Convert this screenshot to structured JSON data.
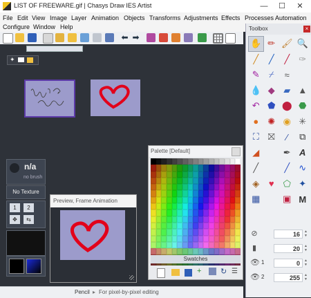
{
  "window": {
    "title": "LIST OF FREEWARE.gif | Chasys Draw IES Artist"
  },
  "menu": [
    "File",
    "Edit",
    "View",
    "Image",
    "Layer",
    "Animation",
    "Objects",
    "Transforms",
    "Adjustments",
    "Effects",
    "Processes",
    "Automation",
    "Configure",
    "Window",
    "Help"
  ],
  "panels": {
    "brush": {
      "name": "n/a",
      "sub": "no brush"
    },
    "texture": {
      "label": "No Texture"
    },
    "frame_buttons": [
      "1",
      "2"
    ],
    "preview_title": "Preview, Frame Animation",
    "palette_title": "Palette [Default]",
    "palette_tab": "Swatches"
  },
  "thumbnail_text": "List of Freeware",
  "toolbox": {
    "title": "Toolbox",
    "close": "×",
    "sliders": [
      {
        "icon": "⊘",
        "label": "",
        "value": "16"
      },
      {
        "icon": "▮",
        "label": "",
        "value": "20"
      },
      {
        "icon": "👁",
        "label": "1",
        "value": "0"
      },
      {
        "icon": "👁",
        "label": "2",
        "value": "255"
      }
    ]
  },
  "status": {
    "tool": "Pencil",
    "hint": "For pixel-by-pixel editing"
  },
  "colors": {
    "accent": "#5c3aa8",
    "thumb": "#9c9bcb",
    "heart": "#e2001a"
  }
}
